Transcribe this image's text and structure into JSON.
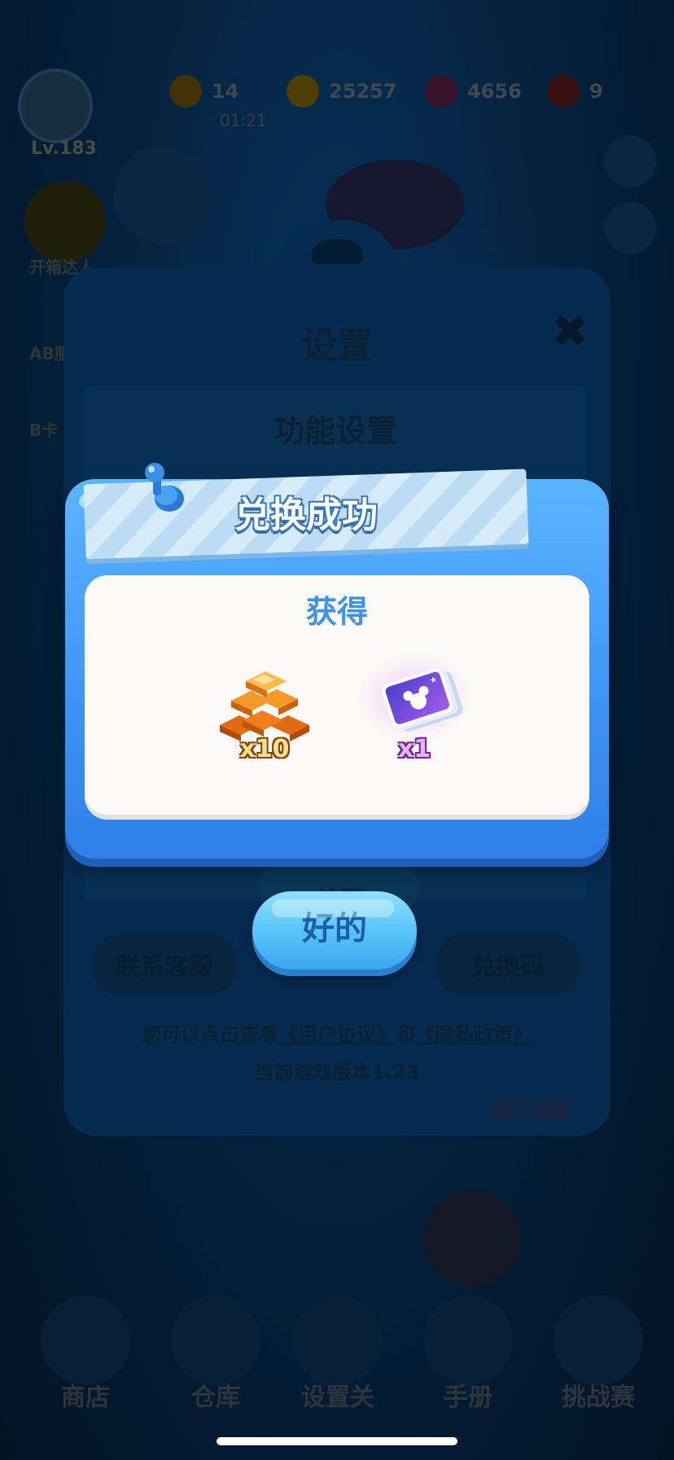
{
  "background": {
    "player_level": "Lv.183",
    "resources": [
      {
        "icon": "coin-bag-icon",
        "value": "14",
        "color": "#7a5a10"
      },
      {
        "icon": "gold-coin-icon",
        "value": "25257",
        "color": "#7a6210"
      },
      {
        "icon": "gem-icon",
        "value": "4656",
        "color": "#6a2050"
      },
      {
        "icon": "ticket-icon",
        "value": "9",
        "color": "#6a2020"
      }
    ],
    "resource_sub": "01:21",
    "side_labels": [
      "开箱达人",
      "AB服",
      "B卡"
    ],
    "bottom_nav": [
      "商店",
      "仓库",
      "设置关",
      "手册",
      "挑战赛"
    ]
  },
  "settings": {
    "title": "设置",
    "close_icon": "close-icon",
    "section_title": "功能设置",
    "close_button": "关闭",
    "contact_button": "联系客服",
    "redeem_button": "兑换码",
    "agreement_prefix": "您可以点击查看",
    "user_agreement": "《用户协议》",
    "and": "和",
    "privacy_policy": "《隐私政策》",
    "version": "当前游戏版本1.23",
    "account_cancel": "账户注销"
  },
  "dialog": {
    "title": "兑换成功",
    "reward_heading": "获得",
    "rewards": [
      {
        "icon": "gold-bars-icon",
        "quantity": "x10"
      },
      {
        "icon": "purple-card-pack-icon",
        "quantity": "x1"
      }
    ],
    "ok_button": "好的"
  }
}
